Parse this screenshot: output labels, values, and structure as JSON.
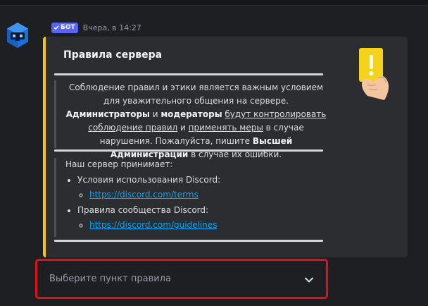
{
  "colors": {
    "background": "#1e1f22",
    "embed_bg": "#2b2d31",
    "embed_accent": "#f0c320",
    "link": "#00a8fc",
    "bot_badge": "#5865f2",
    "highlight": "#e01217"
  },
  "message": {
    "avatar_icon": "robot-avatar-icon",
    "bot_badge": "БОТ",
    "badge_icon": "checkmark-icon",
    "timestamp": "Вчера, в 14:27"
  },
  "embed": {
    "title": "Правила сервера",
    "thumbnail_icon": "yellow-card-hand-icon",
    "paragraph": {
      "p1": "Соблюдение правил и этики является важным условием для уважительного общения на сервере. ",
      "b1": "Администраторы",
      "p2": " и ",
      "b2": "модераторы",
      "p3": " ",
      "u1": "будут контролировать соблюдение правил",
      "p4": " и ",
      "u2": "применять меры",
      "p5": " в случае нарушения. Пожалуйста, пишите ",
      "b3": "Высшей Администрации",
      "p6": " в случае их ошибки."
    },
    "accept_title": "Наш сервер принимает:",
    "items": [
      {
        "label": "Условия использования Discord:",
        "link": "https://discord.com/terms"
      },
      {
        "label": "Правила сообщества Discord:",
        "link": "https://discord.com/guidelines"
      }
    ]
  },
  "select": {
    "placeholder": "Выберите пункт правила",
    "icon": "chevron-down-icon"
  }
}
